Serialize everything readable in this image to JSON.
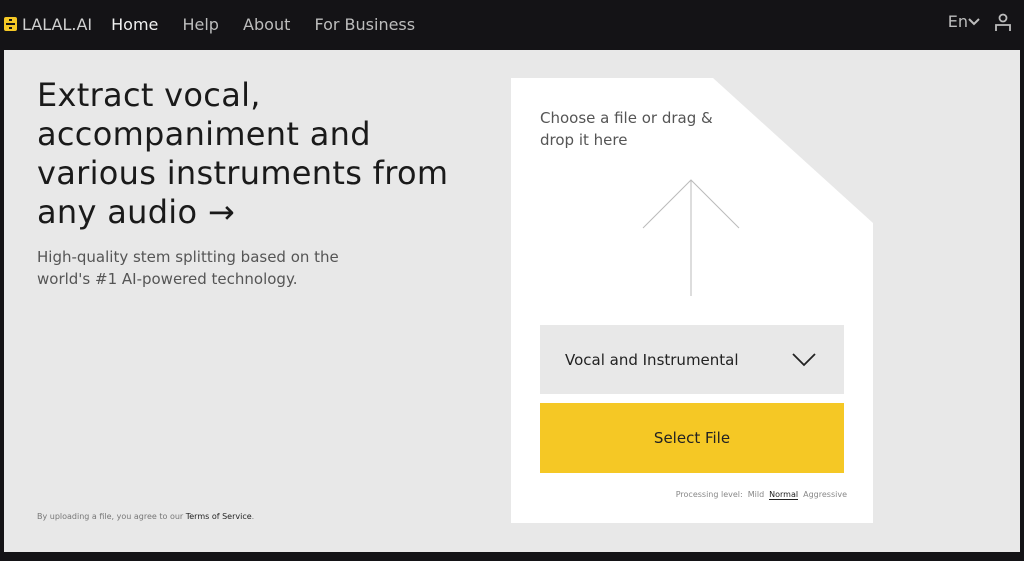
{
  "header": {
    "logo": "LALAL.AI",
    "nav": [
      {
        "label": "Home",
        "active": true
      },
      {
        "label": "Help"
      },
      {
        "label": "About"
      },
      {
        "label": "For Business"
      }
    ],
    "language": "En",
    "icons": [
      "chevron-down-icon",
      "user-icon"
    ]
  },
  "hero": {
    "title": "Extract vocal, accompaniment and various instruments from any audio →",
    "subtitle": "High-quality stem splitting based on the world's #1 AI-powered technology."
  },
  "terms": {
    "prefix": "By uploading a file, you agree to our ",
    "link": "Terms of Service",
    "suffix": "."
  },
  "upload": {
    "prompt": "Choose a file or drag & drop it here",
    "stem_select": "Vocal and Instrumental",
    "select_button": "Select File",
    "processing_label": "Processing level:",
    "levels": [
      "Mild",
      "Normal",
      "Aggressive"
    ],
    "selected_level": "Normal"
  },
  "colors": {
    "accent": "#f5c825",
    "background": "#e8e8e8",
    "header": "#141316"
  }
}
